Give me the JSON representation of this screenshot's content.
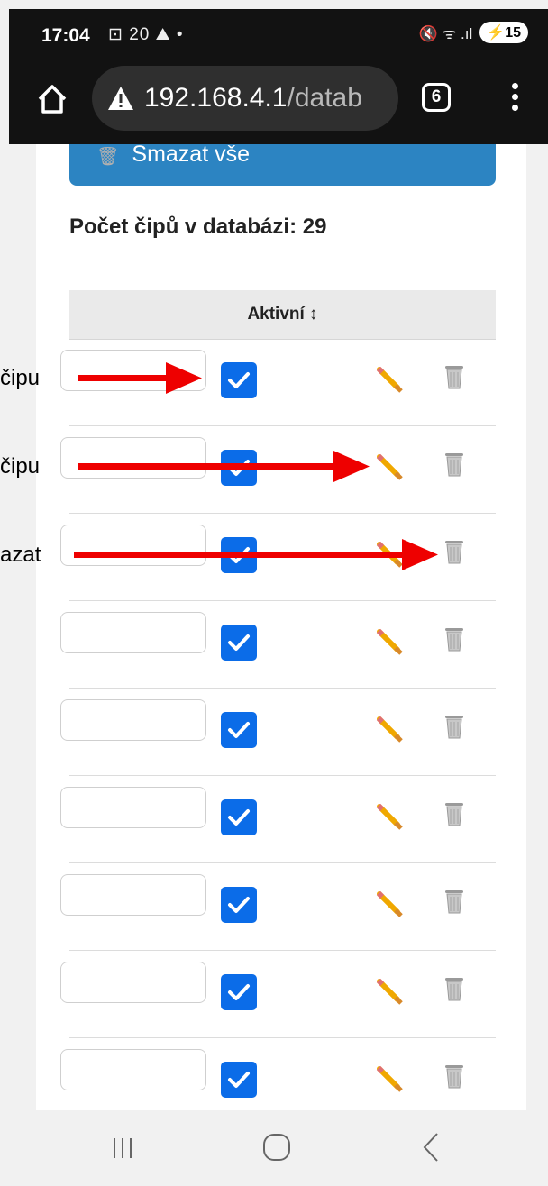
{
  "status_bar": {
    "time": "17:04",
    "icons_text": "⊡ 20 ⛰ •",
    "signal_text": "🔇 ᯤ .ıl",
    "battery": "15"
  },
  "browser": {
    "url_host": "192.168.4.1",
    "url_path": "/datab",
    "tab_count": "6"
  },
  "page": {
    "delete_all_label": "Smazat vše",
    "count_text": "Počet čipů v databázi: 29",
    "table_header": "Aktivní ↕",
    "rows": [
      {
        "active": true
      },
      {
        "active": true
      },
      {
        "active": true
      },
      {
        "active": true
      },
      {
        "active": true
      },
      {
        "active": true
      },
      {
        "active": true
      },
      {
        "active": true
      },
      {
        "active": true
      }
    ]
  },
  "annotations": [
    {
      "label": "čipu"
    },
    {
      "label": "čipu"
    },
    {
      "label": "azat"
    }
  ],
  "colors": {
    "checkbox": "#0b6ce8",
    "button": "#2c84c2",
    "arrow": "#ee0000"
  }
}
